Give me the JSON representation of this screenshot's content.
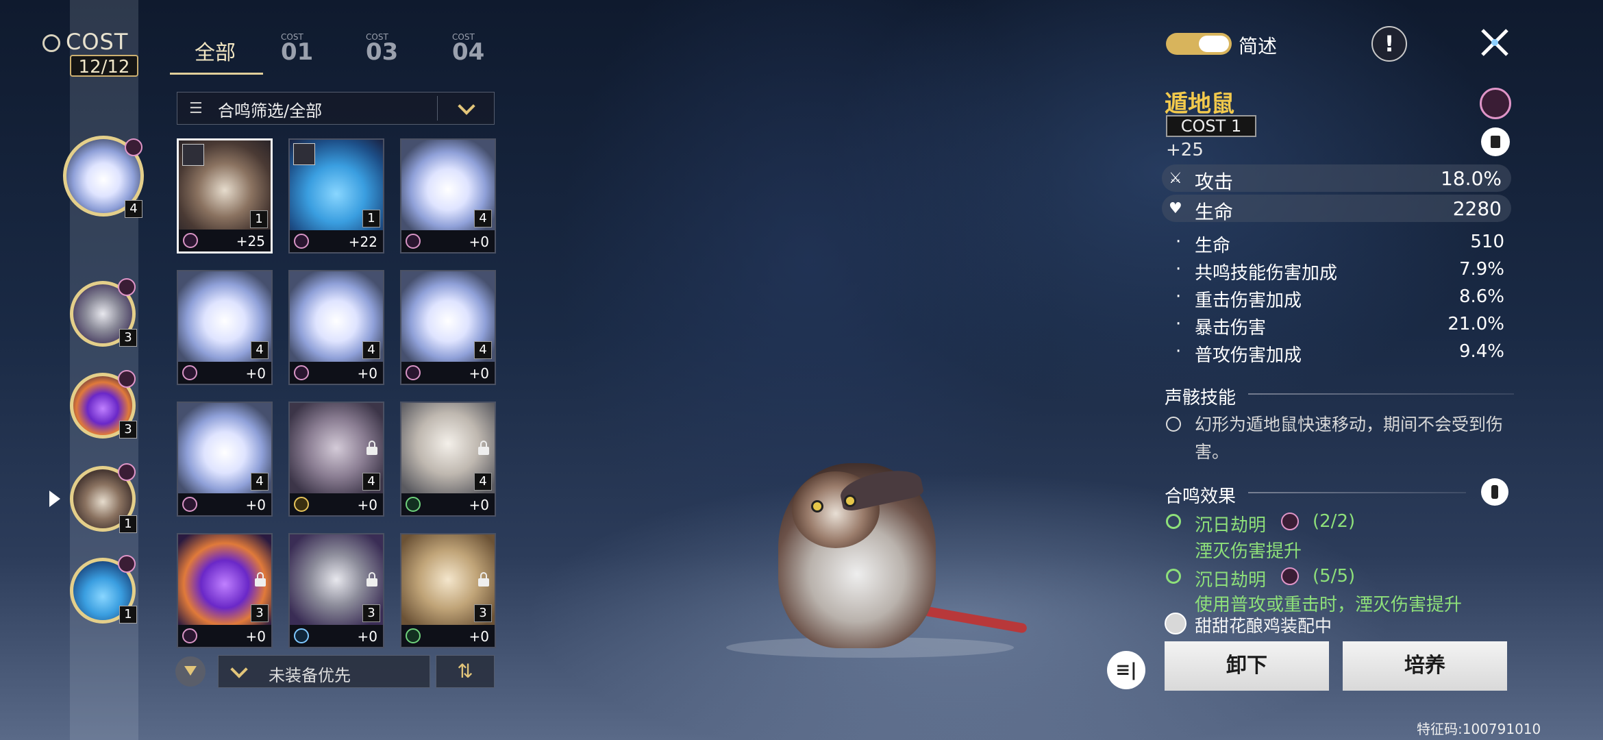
{
  "cost": {
    "label": "COST",
    "value": "12/12"
  },
  "tabs": [
    {
      "label": "全部",
      "cost_prefix": ""
    },
    {
      "label": "01",
      "cost_prefix": "COST"
    },
    {
      "label": "03",
      "cost_prefix": "COST"
    },
    {
      "label": "04",
      "cost_prefix": "COST"
    }
  ],
  "equipped_slots": [
    {
      "cost": "4",
      "art": "white"
    },
    {
      "cost": "3",
      "art": "knight"
    },
    {
      "cost": "3",
      "art": "purple"
    },
    {
      "cost": "1",
      "art": "rat"
    },
    {
      "cost": "1",
      "art": "crystal"
    }
  ],
  "filter": {
    "label": "合鸣筛选/全部"
  },
  "cards": [
    {
      "level": "+25",
      "cost": "1",
      "art": "rat",
      "avatar": true,
      "lock": false,
      "sonata": "pink"
    },
    {
      "level": "+22",
      "cost": "1",
      "art": "crystal",
      "avatar": true,
      "lock": false,
      "sonata": "pink"
    },
    {
      "level": "+0",
      "cost": "4",
      "art": "white",
      "avatar": false,
      "lock": false,
      "sonata": "pink"
    },
    {
      "level": "+0",
      "cost": "4",
      "art": "white",
      "avatar": false,
      "lock": false,
      "sonata": "pink"
    },
    {
      "level": "+0",
      "cost": "4",
      "art": "white",
      "avatar": false,
      "lock": false,
      "sonata": "pink"
    },
    {
      "level": "+0",
      "cost": "4",
      "art": "white",
      "avatar": false,
      "lock": false,
      "sonata": "pink"
    },
    {
      "level": "+0",
      "cost": "4",
      "art": "white",
      "avatar": false,
      "lock": false,
      "sonata": "pink"
    },
    {
      "level": "+0",
      "cost": "4",
      "art": "ram",
      "avatar": false,
      "lock": true,
      "sonata": "gold"
    },
    {
      "level": "+0",
      "cost": "4",
      "art": "ape",
      "avatar": false,
      "lock": true,
      "sonata": "green"
    },
    {
      "level": "+0",
      "cost": "3",
      "art": "purple",
      "avatar": false,
      "lock": true,
      "sonata": "pink"
    },
    {
      "level": "+0",
      "cost": "3",
      "art": "knight",
      "avatar": false,
      "lock": true,
      "sonata": "blue"
    },
    {
      "level": "+0",
      "cost": "3",
      "art": "gold",
      "avatar": false,
      "lock": true,
      "sonata": "green"
    }
  ],
  "sort": {
    "label": "未装备优先",
    "order_icon": "⇅"
  },
  "panel": {
    "toggle_label": "简述",
    "info_icon": "!",
    "echo_name": "遁地鼠",
    "echo_cost": "COST 1",
    "echo_level": "+25",
    "main_stats": [
      {
        "icon": "⚔",
        "label": "攻击",
        "value": "18.0%"
      },
      {
        "icon": "♥",
        "label": "生命",
        "value": "2280"
      }
    ],
    "sub_stats": [
      {
        "label": "生命",
        "value": "510"
      },
      {
        "label": "共鸣技能伤害加成",
        "value": "7.9%"
      },
      {
        "label": "重击伤害加成",
        "value": "8.6%"
      },
      {
        "label": "暴击伤害",
        "value": "21.0%"
      },
      {
        "label": "普攻伤害加成",
        "value": "9.4%"
      }
    ],
    "skill_title": "声骸技能",
    "skill_desc": "幻形为遁地鼠快速移动，期间不会受到伤害。",
    "sonata_title": "合鸣效果",
    "sonata_effects": [
      {
        "name": "沉日劫明",
        "count": "(2/2)",
        "desc": "湮灭伤害提升"
      },
      {
        "name": "沉日劫明",
        "count": "(5/5)",
        "desc": "使用普攻或重击时，湮灭伤害提升"
      }
    ],
    "equipped_by": "甜甜花酿鸡装配中",
    "unequip_label": "卸下",
    "upgrade_label": "培养",
    "fold_icon": "≡|"
  },
  "uid": "特征码:100791010",
  "colors": {
    "accent_gold": "#e2c57a",
    "sonata_green": "#8ee07a",
    "name_yellow": "#f2c94c"
  }
}
